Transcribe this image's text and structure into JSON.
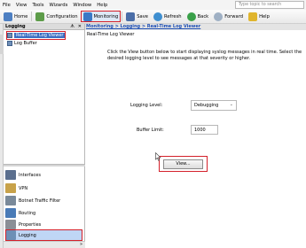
{
  "menu": [
    "File",
    "View",
    "Tools",
    "Wizards",
    "Window",
    "Help"
  ],
  "search": {
    "placeholder": "Type topic to search"
  },
  "toolbar": {
    "home": "Home",
    "configuration": "Configuration",
    "monitoring": "Monitoring",
    "save": "Save",
    "refresh": "Refresh",
    "back": "Back",
    "forward": "Forward",
    "help": "Help"
  },
  "nav": {
    "title": "Logging",
    "pin": "ᗑ",
    "close": "✕",
    "tree": [
      "Real-Time Log Viewer",
      "Log Buffer"
    ],
    "buttons": [
      "Interfaces",
      "VPN",
      "Botnet Traffic Filter",
      "Routing",
      "Properties",
      "Logging"
    ],
    "footer": "»"
  },
  "content": {
    "breadcrumb": "Monitoring > Logging > Real-Time Log Viewer",
    "title": "Real-Time Log Viewer",
    "description": "Click the View button below to start displaying syslog messages in real time. Select the desired logging level to see messages at that severity or higher.",
    "logging_level_label": "Logging Level:",
    "logging_level_value": "Debugging",
    "buffer_limit_label": "Buffer Limit:",
    "buffer_limit_value": "1000",
    "view_button": "View..."
  }
}
